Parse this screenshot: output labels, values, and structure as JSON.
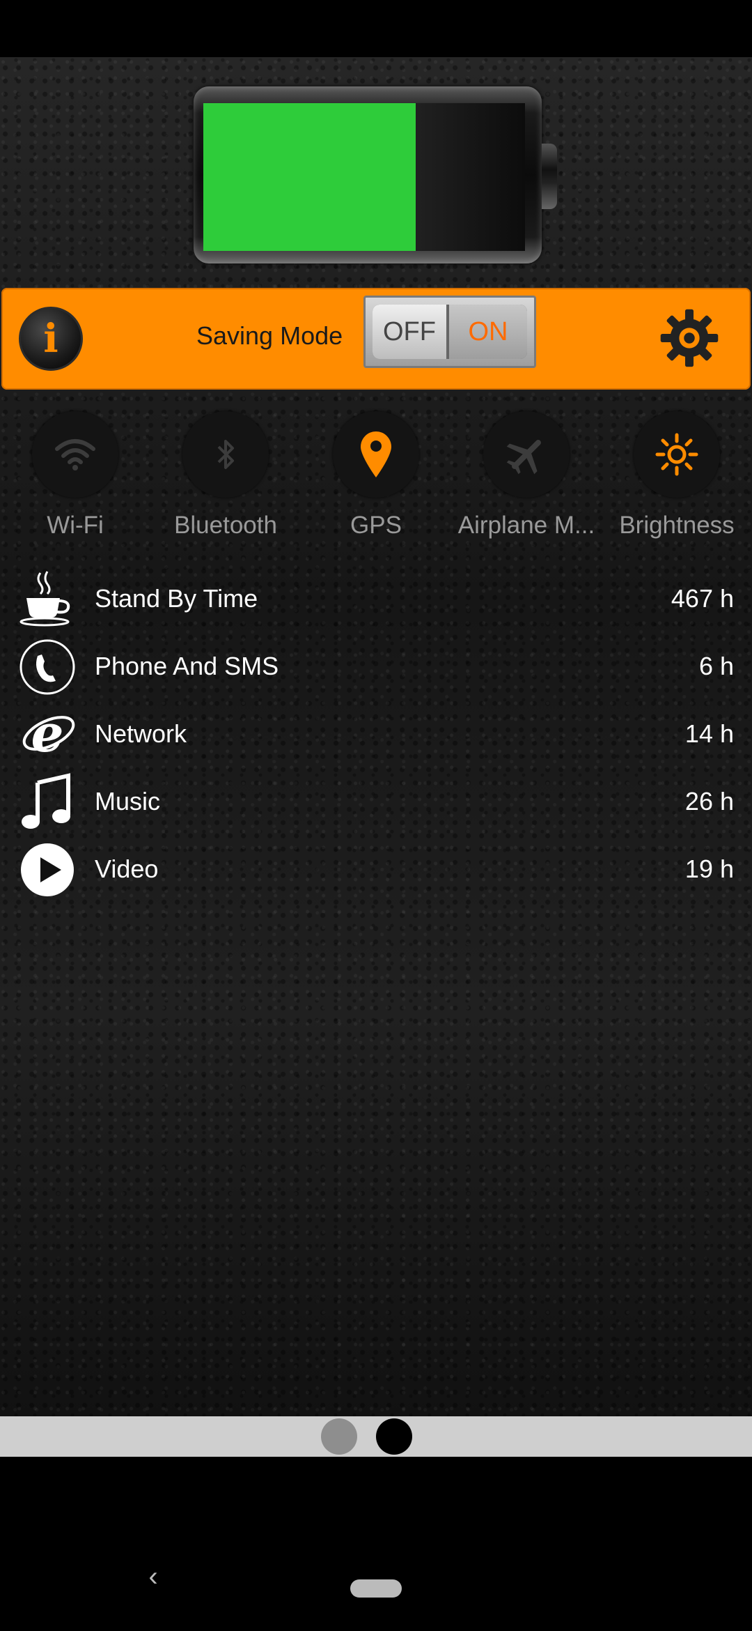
{
  "battery": {
    "level": 0.66,
    "fill_color": "#2ecc3a"
  },
  "saving_bar": {
    "background_color": "#ff8c00",
    "info_icon": "info-icon",
    "label": "Saving Mode",
    "toggle_off": "OFF",
    "toggle_on": "ON",
    "toggle_state": "off",
    "settings_icon": "gear-icon"
  },
  "quick_toggles": [
    {
      "label": "Wi-Fi",
      "icon": "wifi-icon",
      "active": false
    },
    {
      "label": "Bluetooth",
      "icon": "bluetooth-icon",
      "active": false
    },
    {
      "label": "GPS",
      "icon": "location-pin-icon",
      "active": true
    },
    {
      "label": "Airplane M...",
      "icon": "airplane-icon",
      "active": false
    },
    {
      "label": "Brightness",
      "icon": "sun-icon",
      "active": true
    }
  ],
  "usage": [
    {
      "label": "Stand By Time",
      "value": "467 h",
      "icon": "coffee-cup-icon"
    },
    {
      "label": "Phone And SMS",
      "value": "6 h",
      "icon": "phone-icon"
    },
    {
      "label": "Network",
      "value": "14 h",
      "icon": "browser-e-icon"
    },
    {
      "label": "Music",
      "value": "26 h",
      "icon": "music-note-icon"
    },
    {
      "label": "Video",
      "value": "19 h",
      "icon": "play-icon"
    }
  ],
  "pager": {
    "page_count": 2,
    "current_page": 2
  },
  "accent_colors": {
    "active_icon": "#ff8c00",
    "inactive_icon": "#3c3c3c"
  }
}
